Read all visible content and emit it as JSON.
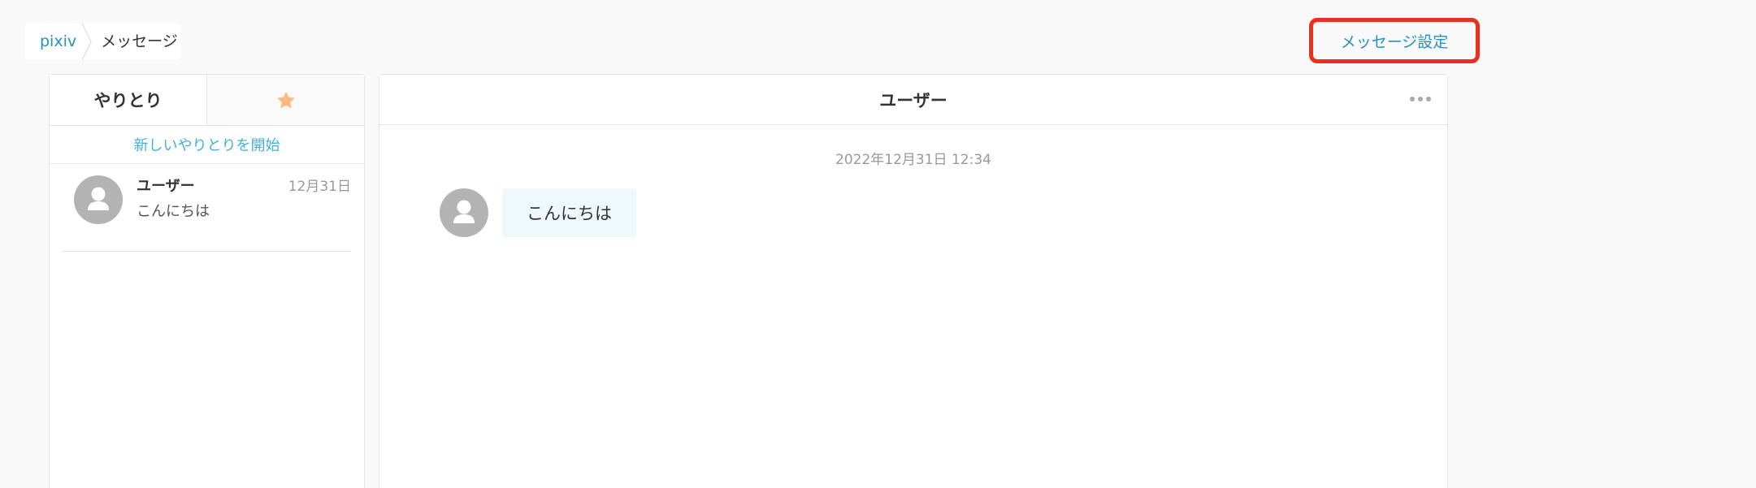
{
  "breadcrumb": {
    "home": "pixiv",
    "current": "メッセージ"
  },
  "header": {
    "settings_label": "メッセージ設定"
  },
  "sidebar": {
    "tabs": [
      {
        "label": "やりとり",
        "active": true
      },
      {
        "icon": "star-icon",
        "color": "#fbb97e"
      }
    ],
    "new_conversation": "新しいやりとりを開始",
    "conversations": [
      {
        "name": "ユーザー",
        "date": "12月31日",
        "preview": "こんにちは"
      }
    ]
  },
  "conversation": {
    "title": "ユーザー",
    "timestamp": "2022年12月31日 12:34",
    "messages": [
      {
        "text": "こんにちは"
      }
    ]
  },
  "colors": {
    "link": "#2593c2",
    "accent": "#43b0d8",
    "highlight_border": "#e8311f",
    "star": "#fbb97e",
    "bubble_bg": "#eef7fa",
    "avatar": "#b3b3b3"
  }
}
